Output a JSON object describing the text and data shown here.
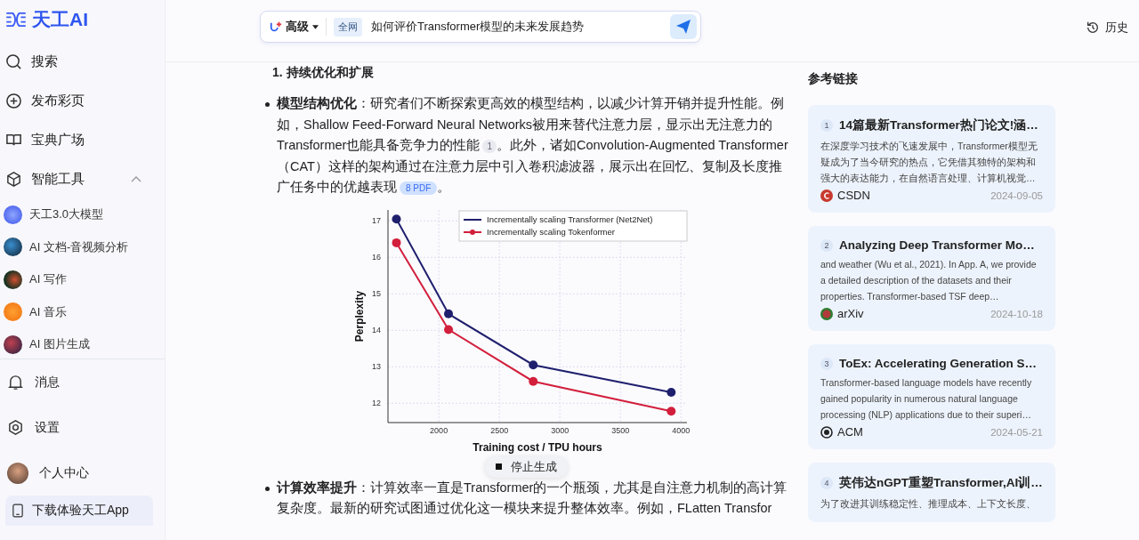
{
  "brand": {
    "name": "天工AI"
  },
  "sidebar": {
    "nav": [
      {
        "label": "搜索",
        "kind": "search"
      },
      {
        "label": "发布彩页",
        "kind": "publish"
      },
      {
        "label": "宝典广场",
        "kind": "book"
      },
      {
        "label": "智能工具",
        "kind": "tools",
        "expanded": true
      }
    ],
    "tools": [
      {
        "label": "天工3.0大模型"
      },
      {
        "label": "AI 文档-音视频分析"
      },
      {
        "label": "AI 写作"
      },
      {
        "label": "AI 音乐"
      },
      {
        "label": "AI 图片生成"
      }
    ],
    "bottom": [
      {
        "label": "消息",
        "kind": "bell"
      },
      {
        "label": "设置",
        "kind": "gear"
      },
      {
        "label": "个人中心",
        "kind": "avatar"
      }
    ],
    "download": {
      "label": "下载体验天工App"
    }
  },
  "search": {
    "mode": "高级",
    "scope": "全网",
    "value": "如何评价Transformer模型的未来发展趋势"
  },
  "history": {
    "label": "历史"
  },
  "answer": {
    "heading": "1. 持续优化和扩展",
    "blocks": [
      {
        "kind": "bullet",
        "parts": [
          {
            "kind": "text",
            "text": "**模型结构优化**：研究者们不断探索更高效的模型结构，以减少计算开销并提升性能。例如，Shallow Feed-Forward Neural Networks被用来替代注意力层，显示出无注意力的Transformer也能具备竞争力的性能"
          },
          {
            "kind": "cite",
            "text": "1"
          },
          {
            "kind": "text",
            "text": "。此外，诸如Convolution-Augmented Transformer（CAT）这样的架构通过在注意力层中引入卷积滤波器，展示出在回忆、复制及长度推广任务中的优越表现"
          },
          {
            "kind": "cite",
            "text": "8 PDF"
          },
          {
            "kind": "text",
            "text": "。"
          }
        ]
      },
      {
        "kind": "chart",
        "chart_data": {
          "type": "line",
          "xlabel": "Training cost / TPU hours",
          "ylabel": "Perplexity",
          "x": [
            1650,
            2080,
            2780,
            3920
          ],
          "series": [
            {
              "name": "Incrementally scaling Transformer (Net2Net)",
              "color": "#1f1f6e",
              "marker": "o",
              "values": [
                17.05,
                14.45,
                13.05,
                12.3
              ]
            },
            {
              "name": "Incrementally scaling Tokenformer",
              "color": "#d21f3c",
              "marker": "o",
              "values": [
                16.4,
                14.02,
                12.6,
                11.78
              ]
            }
          ],
          "grid": true,
          "legend": true,
          "xlim": [
            1580,
            4050
          ],
          "ylim": [
            11.47,
            17.3
          ],
          "xticks": [
            2000,
            2500,
            3000,
            3500,
            4000
          ],
          "yticks": [
            12,
            13,
            14,
            15,
            16,
            17
          ]
        }
      },
      {
        "kind": "bullet",
        "parts": [
          {
            "kind": "text",
            "text": "**计算效率提升**：计算效率一直是Transformer的一个瓶颈，尤其是自注意力机制的高计算复杂度。最新的研究试图通过优化这一模块来提升整体效率。例如，FLatten Transfor"
          }
        ]
      }
    ]
  },
  "stop_button": {
    "label": "停止生成"
  },
  "references": {
    "title": "参考链接",
    "items": [
      {
        "index": "1",
        "title": "14篇最新Transformer热门论文!涵…",
        "snippet": "在深度学习技术的飞速发展中，Transformer模型无疑成为了当今研究的热点，它凭借其独特的架构和强大的表达能力，在自然语言处理、计算机视觉…",
        "source": "CSDN",
        "kind": "csdn",
        "date": "2024-09-05"
      },
      {
        "index": "2",
        "title": "Analyzing Deep Transformer Mo…",
        "snippet": "and weather (Wu et al., 2021). In App. A, we provide a detailed description of the datasets and their properties. Transformer-based TSF deep…",
        "source": "arXiv",
        "kind": "arxiv",
        "date": "2024-10-18"
      },
      {
        "index": "3",
        "title": "ToEx: Accelerating Generation S…",
        "snippet": "Transformer-based language models have recently gained popularity in numerous natural language processing (NLP) applications due to their superi…",
        "source": "ACM",
        "kind": "acm",
        "date": "2024-05-21"
      },
      {
        "index": "4",
        "title": "英伟达nGPT重塑Transformer,AI训…",
        "snippet": "为了改进其训练稳定性、推理成本、上下文长度、"
      }
    ]
  }
}
